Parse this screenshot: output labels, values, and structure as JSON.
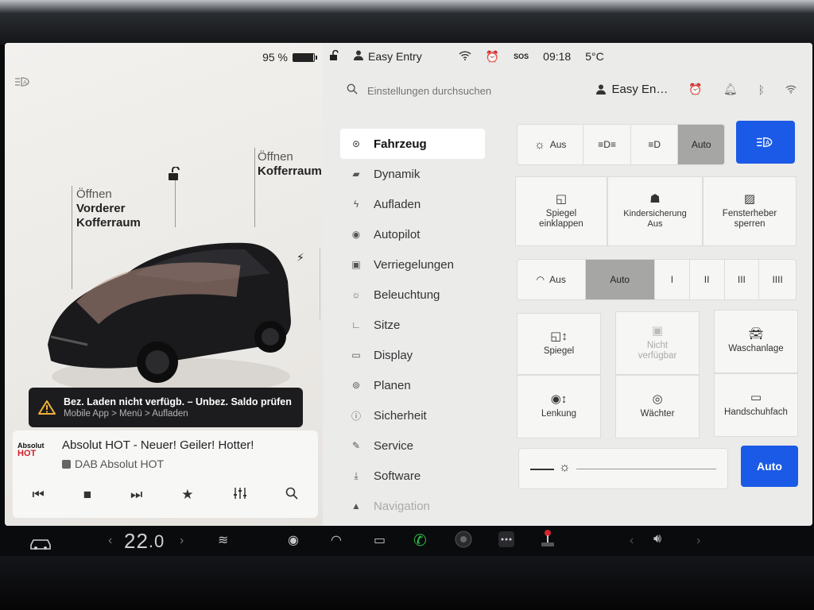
{
  "battery": {
    "percent_label": "95 %",
    "level": 0.95
  },
  "car_panel": {
    "front_trunk": {
      "action": "Öffnen",
      "name_line1": "Vorderer",
      "name_line2": "Kofferraum"
    },
    "rear_trunk": {
      "action": "Öffnen",
      "name": "Kofferraum"
    }
  },
  "alert": {
    "title": "Bez. Laden nicht verfügb. – Unbez. Saldo prüfen",
    "subtitle": "Mobile App > Menü > Aufladen"
  },
  "media": {
    "logo_line1": "Absolut",
    "logo_line2": "HOT",
    "title": "Absolut HOT - Neuer! Geiler! Hotter!",
    "station": "DAB Absolut HOT"
  },
  "status_bar": {
    "profile": "Easy Entry",
    "sos": "SOS",
    "time": "09:18",
    "temperature": "5°C"
  },
  "search": {
    "placeholder": "Einstellungen durchsuchen",
    "profile_short": "Easy En…"
  },
  "nav": {
    "items": [
      {
        "label": "Fahrzeug",
        "icon": "toggle-icon"
      },
      {
        "label": "Dynamik",
        "icon": "car-icon"
      },
      {
        "label": "Aufladen",
        "icon": "bolt-icon"
      },
      {
        "label": "Autopilot",
        "icon": "steering-wheel-icon"
      },
      {
        "label": "Verriegelungen",
        "icon": "lock-icon"
      },
      {
        "label": "Beleuchtung",
        "icon": "sun-icon"
      },
      {
        "label": "Sitze",
        "icon": "seat-icon"
      },
      {
        "label": "Display",
        "icon": "display-icon"
      },
      {
        "label": "Planen",
        "icon": "alarm-clock-icon"
      },
      {
        "label": "Sicherheit",
        "icon": "info-circle-icon"
      },
      {
        "label": "Service",
        "icon": "wrench-icon"
      },
      {
        "label": "Software",
        "icon": "download-icon"
      },
      {
        "label": "Navigation",
        "icon": "navigation-icon"
      }
    ]
  },
  "lights": {
    "off": "Aus",
    "auto": "Auto"
  },
  "quick_tiles": [
    {
      "line1": "Spiegel",
      "line2": "einklappen"
    },
    {
      "line1": "Kindersicherung",
      "line2": "Aus"
    },
    {
      "line1": "Fensterheber",
      "line2": "sperren"
    }
  ],
  "wipers": {
    "off": "Aus",
    "auto": "Auto",
    "speeds": [
      "I",
      "II",
      "III",
      "IIII"
    ]
  },
  "controls": {
    "mirror": "Spiegel",
    "unavailable_line1": "Nicht",
    "unavailable_line2": "verfügbar",
    "carwash": "Waschanlage",
    "steering": "Lenkung",
    "sentry": "Wächter",
    "glovebox": "Handschuhfach"
  },
  "brightness": {
    "auto_label": "Auto"
  },
  "dock": {
    "cabin_temp_whole": "22",
    "cabin_temp_frac": ".0"
  },
  "colors": {
    "accent_blue": "#1b5ae6",
    "alert_bg": "#1c1c1e",
    "selected_segment": "#a6a6a5",
    "call_green": "#2fbf4a"
  }
}
